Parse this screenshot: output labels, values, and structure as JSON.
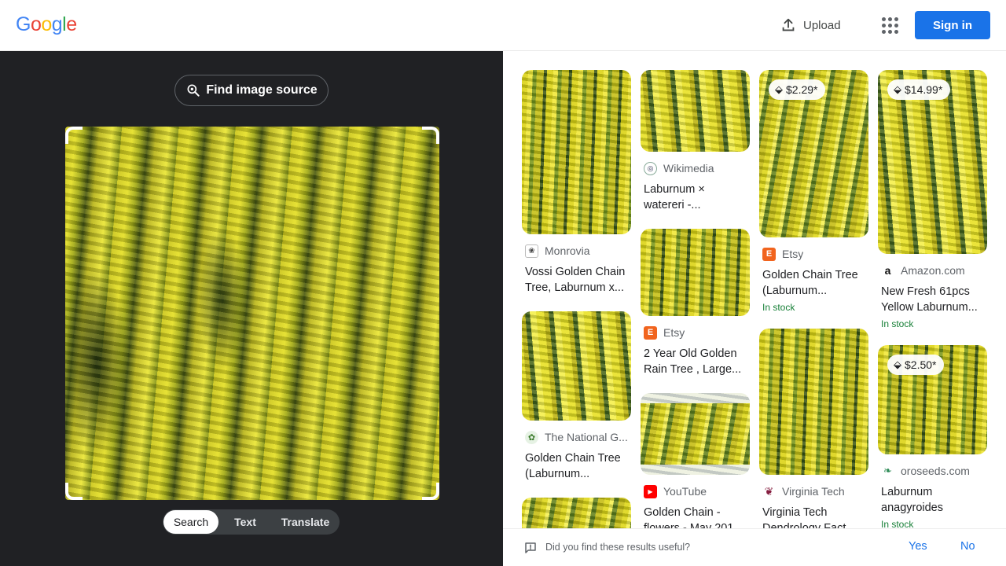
{
  "header": {
    "logo_letters": [
      "G",
      "o",
      "o",
      "g",
      "l",
      "e"
    ],
    "logo_colors": [
      "#4285F4",
      "#EA4335",
      "#FBBC05",
      "#4285F4",
      "#34A853",
      "#EA4335"
    ],
    "upload_label": "Upload",
    "apps_icon": "apps-grid-icon",
    "signin_label": "Sign in"
  },
  "lens": {
    "find_source_label": "Find image source",
    "query_image_alt": "Yellow laburnum flowers",
    "modes": [
      "Search",
      "Text",
      "Translate"
    ],
    "active_mode": "Search"
  },
  "results": {
    "col1": [
      {
        "source": "Monrovia",
        "title": "Vossi Golden Chain Tree, Laburnum x...",
        "icon": "monrovia-icon"
      },
      {
        "source": "The National G...",
        "title": "Golden Chain Tree (Laburnum...",
        "icon": "national-garden-icon"
      },
      {
        "source": "",
        "title": "",
        "icon": ""
      }
    ],
    "col2": [
      {
        "source": "Wikimedia",
        "title": "Laburnum × watereri -...",
        "icon": "wikimedia-icon"
      },
      {
        "source": "Etsy",
        "title": "2 Year Old Golden Rain Tree , Large...",
        "icon": "etsy-icon"
      },
      {
        "source": "YouTube",
        "title": "Golden Chain - flowers - May 201...",
        "icon": "youtube-icon"
      }
    ],
    "col3": [
      {
        "source": "Etsy",
        "title": "Golden Chain Tree (Laburnum...",
        "price": "$2.29*",
        "stock": "In stock",
        "icon": "etsy-icon"
      },
      {
        "source": "Virginia Tech",
        "title": "Virginia Tech Dendrology Fact...",
        "icon": "virginia-tech-icon"
      }
    ],
    "col4": [
      {
        "source": "Amazon.com",
        "title": "New Fresh 61pcs Yellow Laburnum...",
        "price": "$14.99*",
        "stock": "In stock",
        "icon": "amazon-icon"
      },
      {
        "source": "oroseeds.com",
        "title": "Laburnum anagyroides",
        "price": "$2.50*",
        "stock": "In stock",
        "icon": "oroseeds-icon"
      }
    ]
  },
  "feedback": {
    "question": "Did you find these results useful?",
    "yes": "Yes",
    "no": "No"
  }
}
